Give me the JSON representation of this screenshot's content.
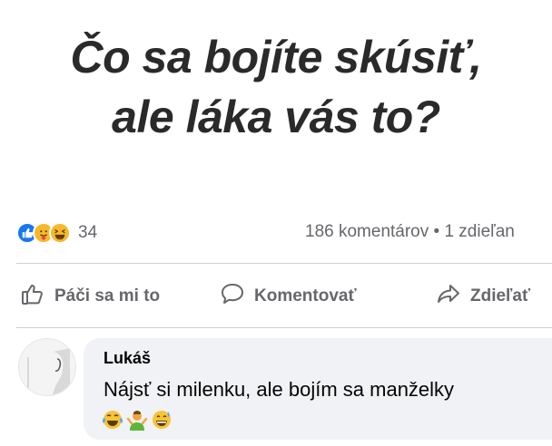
{
  "post": {
    "title_line1": "Čo sa bojíte skúsiť,",
    "title_line2": "ale láka vás to?"
  },
  "stats": {
    "reactions": [
      "like-icon",
      "care-icon",
      "haha-icon"
    ],
    "reaction_count": "34",
    "comments_shares": "186 komentárov • 1 zdieľan"
  },
  "actions": {
    "like_label": "Páči sa mi to",
    "comment_label": "Komentovať",
    "share_label": "Zdieľať"
  },
  "comment": {
    "author": "Lukáš",
    "text": "Nájsť si milenku, ale bojím sa manželky",
    "emojis": [
      "crying-laughing-emoji-icon",
      "person-gesturing-emoji-icon",
      "grinning-sweat-emoji-icon"
    ]
  },
  "colors": {
    "facebook_blue": "#1877f2",
    "reaction_yellow": "#f7b928",
    "muted_text": "#65676b",
    "bubble_bg": "#f0f2f5",
    "divider": "#ced0d4"
  }
}
